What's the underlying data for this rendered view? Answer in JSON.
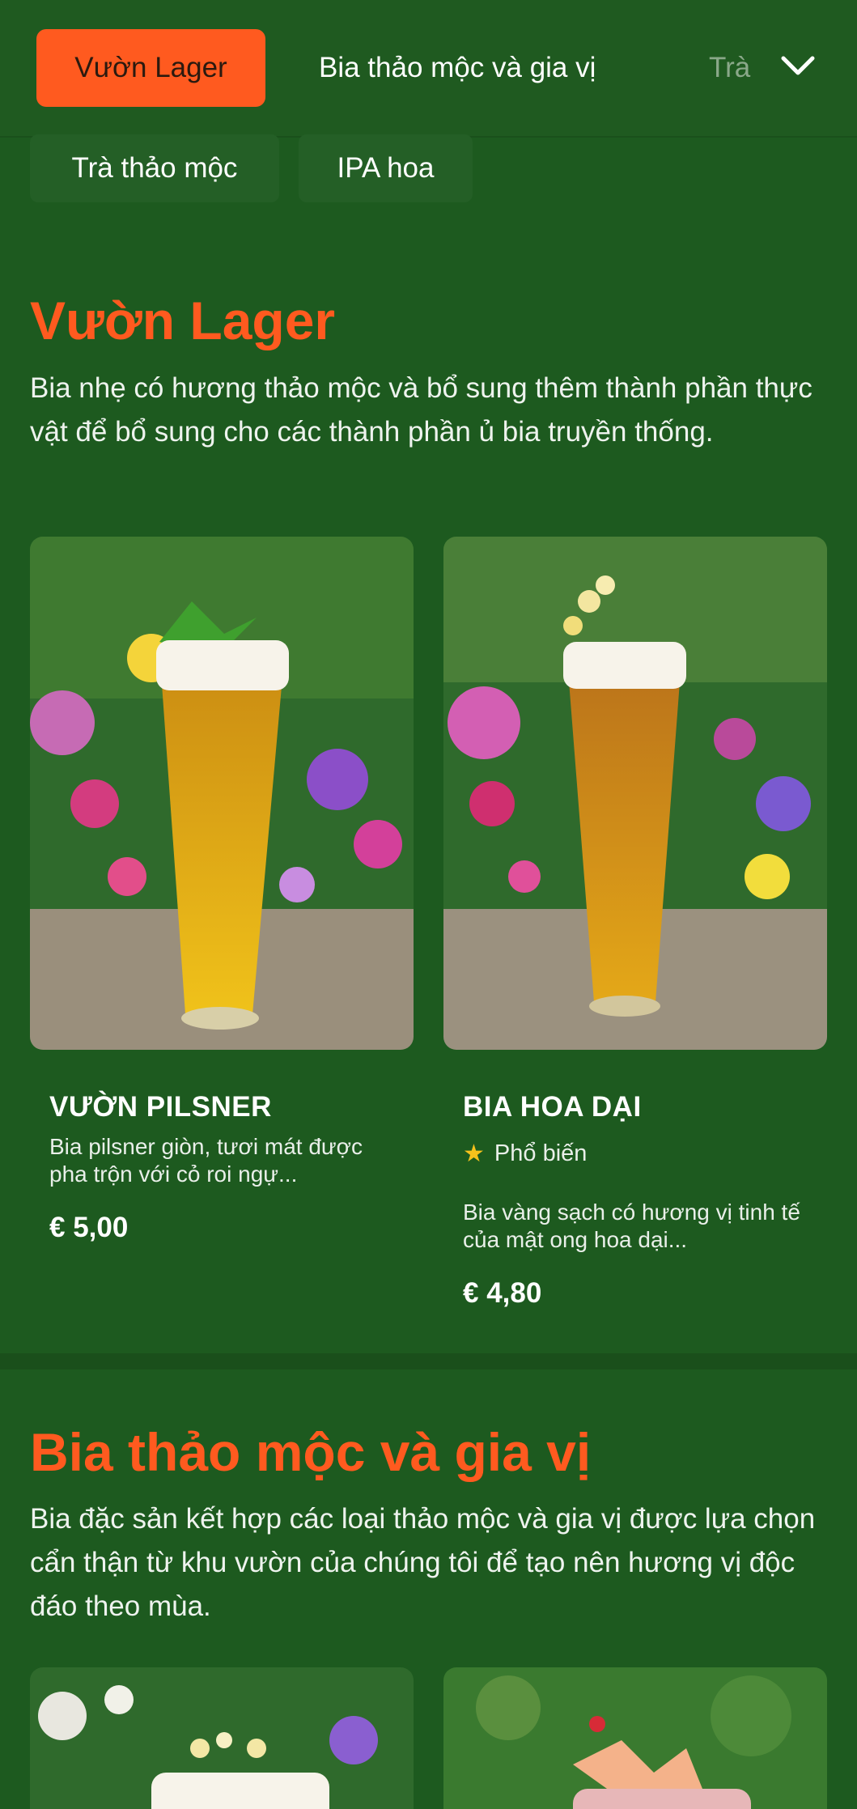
{
  "nav": {
    "tabs": [
      {
        "label": "Vườn Lager",
        "active": true
      },
      {
        "label": "Bia thảo mộc và gia vị",
        "active": false
      },
      {
        "label": "Trà",
        "active": false
      }
    ],
    "expand_icon": "chevron-down-icon",
    "chips": [
      "Trà thảo mộc",
      "IPA hoa"
    ]
  },
  "colors": {
    "accent": "#ff5a1f",
    "background": "#1d5a1f",
    "star": "#f6c21c"
  },
  "sections": [
    {
      "title": "Vườn Lager",
      "description": "Bia nhẹ có hương thảo mộc và bổ sung thêm thành phần thực vật để bổ sung cho các thành phần ủ bia truyền thống.",
      "products": [
        {
          "name": "VƯỜN PILSNER",
          "description": "Bia pilsner giòn, tươi mát được pha trộn với cỏ roi ngự...",
          "price": "€ 5,00",
          "badge": ""
        },
        {
          "name": "BIA HOA DẠI",
          "description": "Bia vàng sạch có hương vị tinh tế của mật ong hoa dại...",
          "price": "€ 4,80",
          "badge": "Phổ biến"
        }
      ]
    },
    {
      "title": "Bia thảo mộc và gia vị",
      "description": "Bia đặc sản kết hợp các loại thảo mộc và gia vị được lựa chọn cẩn thận từ khu vườn của chúng tôi để tạo nên hương vị độc đáo theo mùa."
    }
  ]
}
